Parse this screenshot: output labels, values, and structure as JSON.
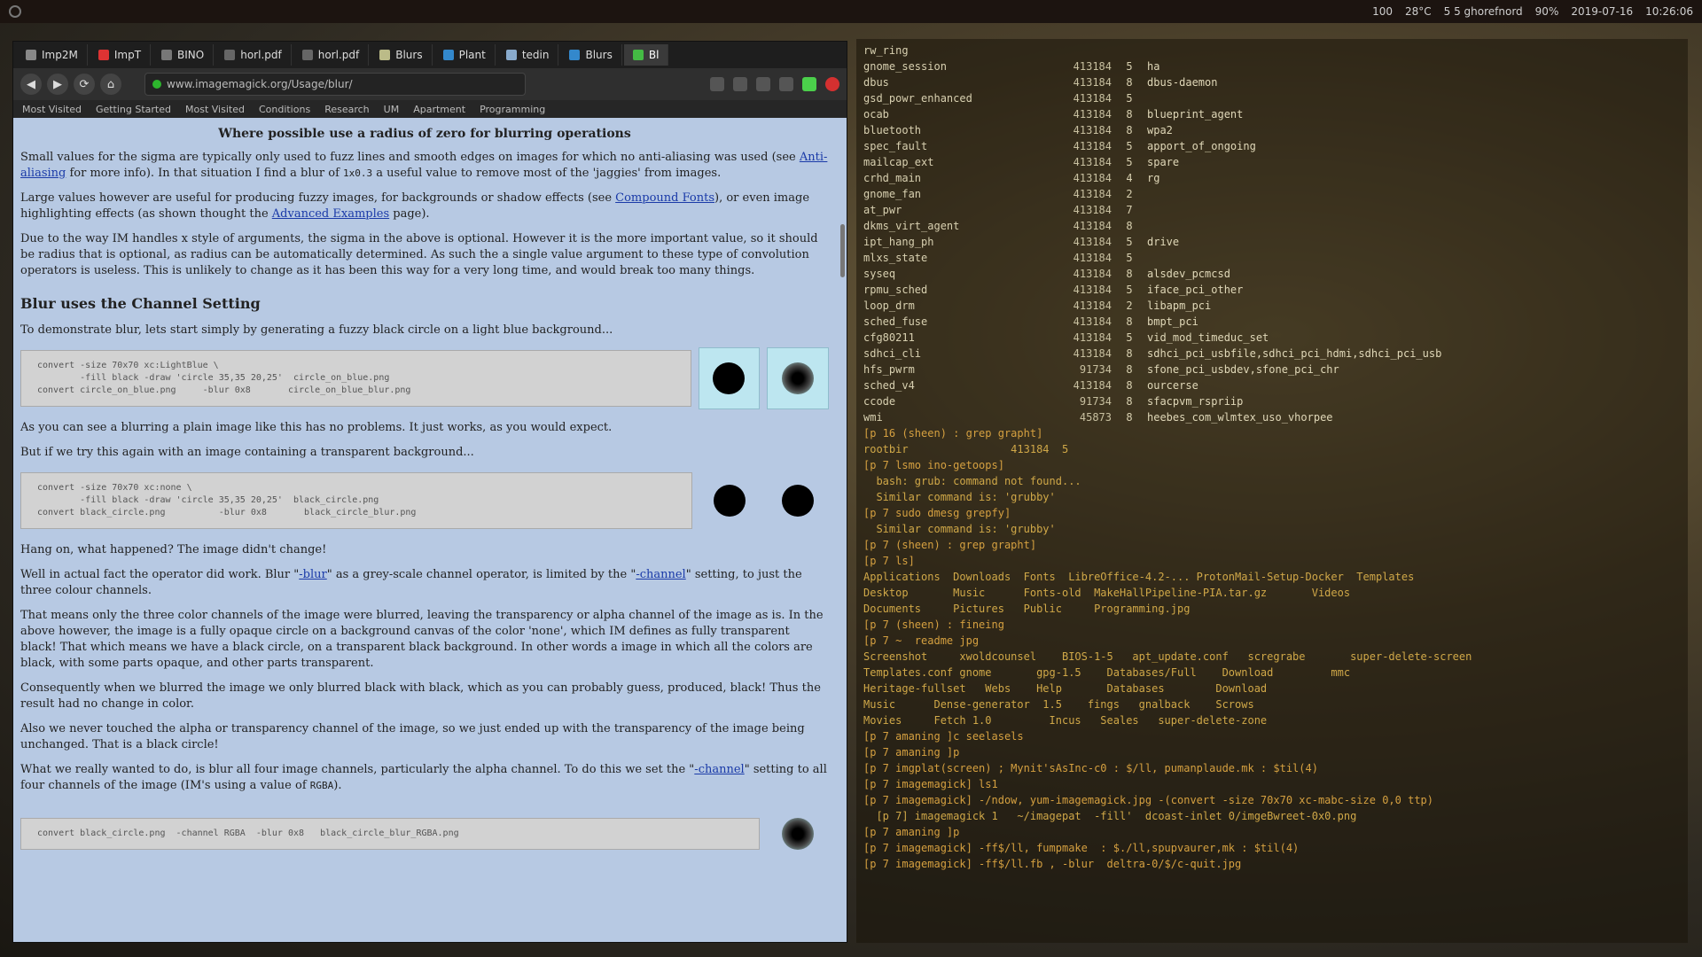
{
  "topbar": {
    "status": [
      "100",
      "28°C",
      "5 5 ghorefnord",
      "90%",
      "2019-07-16",
      "10:26:06"
    ]
  },
  "browser": {
    "tabs": [
      "Imp2M",
      "ImpT",
      "BINO",
      "horl.pdf",
      "horl.pdf",
      "Blurs",
      "Plant",
      "tedin",
      "Blurs",
      "Bl"
    ],
    "url": "www.imagemagick.org/Usage/blur/",
    "bookmarks": [
      "Most Visited",
      "Getting Started",
      "Most Visited",
      "Conditions",
      "Research",
      "UM",
      "Apartment",
      "Programming"
    ]
  },
  "page": {
    "heading": "Where possible use a radius of zero for blurring operations",
    "p1_a": "Small values for the sigma are typically only used to fuzz lines and smooth edges on images for which no anti-aliasing was used (see ",
    "p1_link": "Anti-aliasing",
    "p1_b": " for more info). In that situation I find a blur of ",
    "p1_code": "1x0.3",
    "p1_c": " a useful value to remove most of the 'jaggies' from images.",
    "p2_a": "Large values however are useful for producing fuzzy images, for backgrounds or shadow effects (see ",
    "p2_link": "Compound Fonts",
    "p2_b": "), or even image highlighting effects (as shown thought the ",
    "p2_link2": "Advanced Examples",
    "p2_c": " page).",
    "p3": "Due to the way IM handles x style of arguments, the sigma in the above is optional. However it is the more important value, so it should be radius that is optional, as radius can be automatically determined. As such the a single value argument to these type of convolution operators is useless. This is unlikely to change as it has been this way for a very long time, and would break too many things.",
    "section": "Blur uses the Channel Setting",
    "p4": "To demonstrate blur, lets start simply by generating a fuzzy black circle on a light blue background...",
    "cmd1": "convert -size 70x70 xc:LightBlue \\\n        -fill black -draw 'circle 35,35 20,25'  circle_on_blue.png\nconvert circle_on_blue.png     -blur 0x8       circle_on_blue_blur.png",
    "p5": "As you can see a blurring a plain image like this has no problems. It just works, as you would expect.",
    "p6": "But if we try this again with an image containing a transparent background...",
    "cmd2": "convert -size 70x70 xc:none \\\n        -fill black -draw 'circle 35,35 20,25'  black_circle.png\nconvert black_circle.png          -blur 0x8       black_circle_blur.png",
    "p7": "Hang on, what happened? The image didn't change!",
    "p8_a": "Well in actual fact the operator did work. Blur \"",
    "p8_link": "-blur",
    "p8_b": "\" as a grey-scale channel operator, is limited by the \"",
    "p8_link2": "-channel",
    "p8_c": "\" setting, to just the three colour channels.",
    "p9": "That means only the three color channels of the image were blurred, leaving the transparency or alpha channel of the image as is. In the above however, the image is a fully opaque circle on a background canvas of the color 'none', which IM defines as fully transparent black! That which means we have a black circle, on a transparent black background. In other words a image in which all the colors are black, with some parts opaque, and other parts transparent.",
    "p10": "Consequently when we blurred the image we only blurred black with black, which as you can probably guess, produced, black! Thus the result had no change in color.",
    "p11": "Also we never touched the alpha or transparency channel of the image, so we just ended up with the transparency of the image being unchanged. That is a black circle!",
    "p12_a": "What we really wanted to do, is blur all four image channels, particularly the alpha channel. To do this we set the \"",
    "p12_link": "-channel",
    "p12_b": "\" setting to all four channels of the image (IM's using a value of ",
    "p12_code": "RGBA",
    "p12_c": ").",
    "cmd3": "convert black_circle.png  -channel RGBA  -blur 0x8   black_circle_blur_RGBA.png"
  },
  "terminal": {
    "rows": [
      [
        "rw_ring",
        "",
        "",
        ""
      ],
      [
        "gnome_session",
        "413184",
        "5",
        "ha"
      ],
      [
        "dbus",
        "413184",
        "8",
        "dbus-daemon"
      ],
      [
        "gsd_powr_enhanced",
        "413184",
        "5",
        ""
      ],
      [
        "ocab",
        "413184",
        "8",
        "blueprint_agent"
      ],
      [
        "bluetooth",
        "413184",
        "8",
        "wpa2"
      ],
      [
        "spec_fault",
        "413184",
        "5",
        "apport_of_ongoing"
      ],
      [
        "mailcap_ext",
        "413184",
        "5",
        "spare"
      ],
      [
        "crhd_main",
        "413184",
        "4",
        "rg"
      ],
      [
        "gnome_fan",
        "413184",
        "2",
        ""
      ],
      [
        "at_pwr",
        "413184",
        "7",
        ""
      ],
      [
        "dkms_virt_agent",
        "413184",
        "8",
        ""
      ],
      [
        "ipt_hang_ph",
        "413184",
        "5",
        "drive"
      ],
      [
        "mlxs_state",
        "413184",
        "5",
        ""
      ],
      [
        "syseq",
        "413184",
        "8",
        "alsdev_pcmcsd"
      ],
      [
        "rpmu_sched",
        "413184",
        "5",
        "iface_pci_other"
      ],
      [
        "loop_drm",
        "413184",
        "2",
        "libapm_pci"
      ],
      [
        "sched_fuse",
        "413184",
        "8",
        "bmpt_pci"
      ],
      [
        "cfg80211",
        "413184",
        "5",
        "vid_mod_timeduc_set"
      ],
      [
        "sdhci_cli",
        "413184",
        "8",
        "sdhci_pci_usbfile,sdhci_pci_hdmi,sdhci_pci_usb"
      ],
      [
        "hfs_pwrm",
        "91734",
        "8",
        "sfone_pci_usbdev,sfone_pci_chr"
      ],
      [
        "sched_v4",
        "413184",
        "8",
        "ourcerse"
      ],
      [
        "ccode",
        "91734",
        "8",
        "sfacpvm_rspriip"
      ],
      [
        "wmi",
        "45873",
        "8",
        "heebes_com_wlmtex_uso_vhorpee"
      ]
    ],
    "lines": [
      "[p 16 (sheen) : grep grapht]",
      "rootbir                413184  5",
      "[p 7 lsmo ino-getoops]",
      "  bash: grub: command not found...",
      "  Similar command is: 'grubby'",
      "[p 7 sudo dmesg grepfy]",
      "  Similar command is: 'grubby'",
      "[p 7 (sheen) : grep grapht]",
      "[p 7 ls]",
      "Applications  Downloads  Fonts  LibreOffice-4.2-... ProtonMail-Setup-Docker  Templates",
      "Desktop       Music      Fonts-old  MakeHallPipeline-PIA.tar.gz       Videos",
      "Documents     Pictures   Public     Programming.jpg",
      "[p 7 (sheen) : fineing",
      "[p 7 ~  readme jpg",
      "Screenshot     xwoldcounsel    BIOS-1-5   apt_update.conf   scregrabe       super-delete-screen",
      "Templates.conf gnome       gpg-1.5    Databases/Full    Download         mmc",
      "Heritage-fullset   Webs    Help       Databases        Download",
      "Music      Dense-generator  1.5    fings   gnalback    Scrows",
      "Movies     Fetch 1.0         Incus   Seales   super-delete-zone",
      "[p 7 amaning ]c seelasels",
      "[p 7 amaning ]p",
      "[p 7 imgplat(screen) ; Mynit'sAsInc-c0 : $/ll, pumanplaude.mk : $til(4)",
      "[p 7 imagemagick] ls1",
      "[p 7 imagemagick] -/ndow, yum-imagemagick.jpg -(convert -size 70x70 xc-mabc-size 0,0 ttp)",
      "  [p 7] imagemagick 1   ~/imagepat  -fill'  dcoast-inlet 0/imgeBwreet-0x0.png",
      "[p 7 amaning ]p",
      "[p 7 imagemagick] -ff$/ll, fumpmake  : $./ll,spupvaurer,mk : $til(4)",
      "[p 7 imagemagick] -ff$/ll.fb , -blur  deltra-0/$/c-quit.jpg"
    ]
  }
}
